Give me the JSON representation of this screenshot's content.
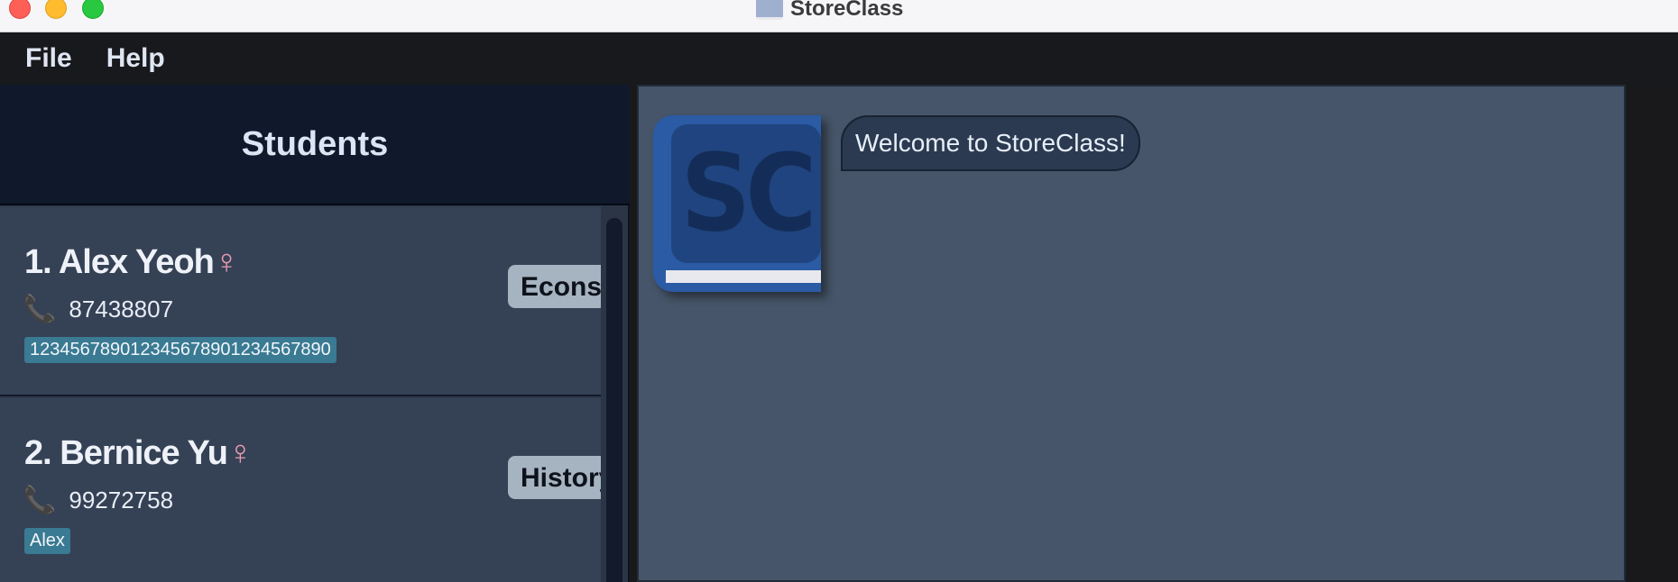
{
  "window": {
    "title": "StoreClass"
  },
  "menu": {
    "file": "File",
    "help": "Help"
  },
  "students_panel": {
    "title": "Students",
    "students": [
      {
        "name": "1. Alex Yeoh",
        "gender_symbol": "♀",
        "phone_icon": "phone-icon",
        "phone": "87438807",
        "tag": "123456789012345678901234567890",
        "subject": "Econs"
      },
      {
        "name": "2. Bernice Yu",
        "gender_symbol": "♀",
        "phone_icon": "phone-icon",
        "phone": "99272758",
        "tag": "Alex",
        "subject": "History"
      }
    ]
  },
  "chat": {
    "logo_text": "SC",
    "welcome": "Welcome to StoreClass!"
  },
  "colors": {
    "tag_bg": "#3a7a92",
    "subject_bg": "#a6b3c0",
    "gender_color": "#e89ab2",
    "logo_blue": "#2b5ba5"
  }
}
